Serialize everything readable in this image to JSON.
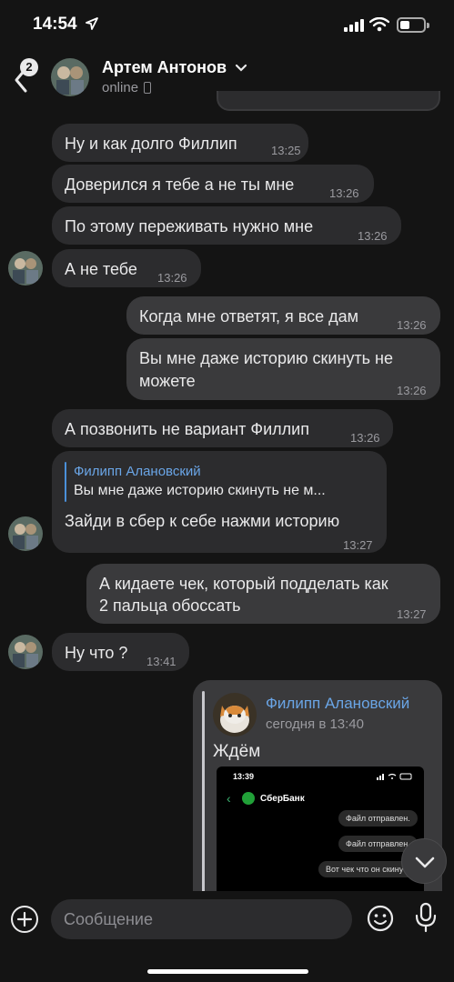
{
  "status_bar": {
    "time": "14:54"
  },
  "header": {
    "back_badge": "2",
    "contact_name": "Артем Антонов",
    "status": "online"
  },
  "messages": [
    {
      "text": "Ну и как долго Филлип",
      "time": "13:25"
    },
    {
      "text": "Доверился я тебе а не ты мне",
      "time": "13:26"
    },
    {
      "text": "По этому переживать нужно мне",
      "time": "13:26"
    },
    {
      "text": "А не тебе",
      "time": "13:26"
    },
    {
      "text": "Когда мне ответят, я все дам",
      "time": "13:26"
    },
    {
      "text_line1": "Вы мне даже историю скинуть не",
      "text_line2": "можете",
      "time": "13:26"
    },
    {
      "text": "А позвонить не вариант Филлип",
      "time": "13:26"
    },
    {
      "reply_name": "Филипп Алановский",
      "reply_text": "Вы мне даже историю скинуть не м...",
      "text": "Зайди в сбер к себе нажми историю",
      "time": "13:27"
    },
    {
      "text_line1": "А кидаете чек, который подделать как",
      "text_line2": "2 пальца обоссать",
      "time": "13:27"
    },
    {
      "text": "Ну что ?",
      "time": "13:41"
    }
  ],
  "forwarded": {
    "name": "Филипп Алановский",
    "date": "сегодня в 13:40",
    "text": "Ждём",
    "screenshot": {
      "time": "13:39",
      "bank": "СберБанк",
      "msgs": [
        "Файл отправлен.",
        "Файл отправлен.",
        "Вот чек что он скину"
      ]
    }
  },
  "composer": {
    "placeholder": "Сообщение"
  }
}
